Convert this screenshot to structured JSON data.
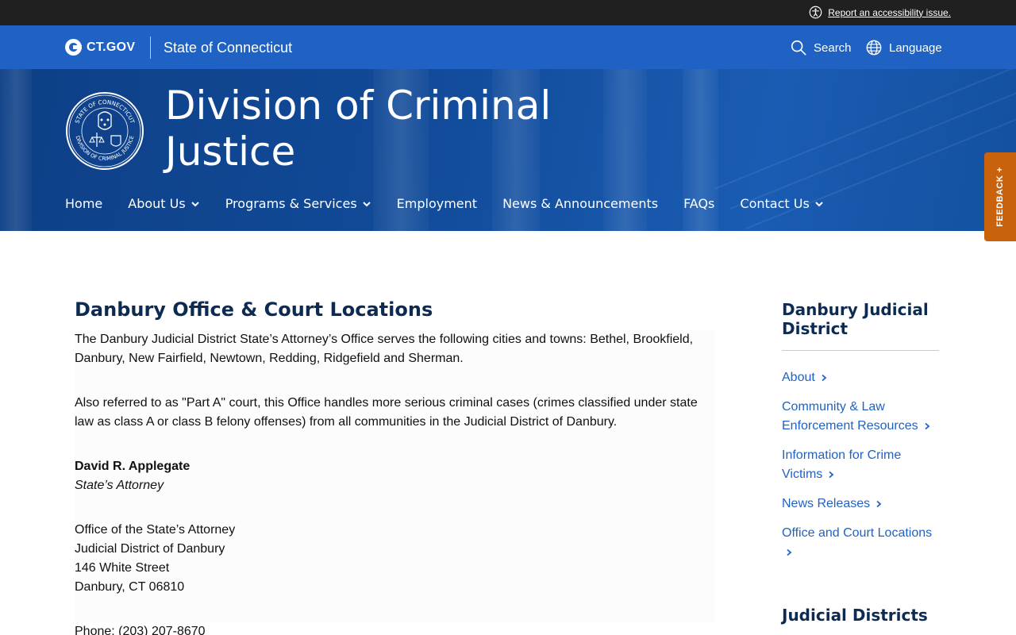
{
  "utility": {
    "accessibility_link": "Report an accessibility issue."
  },
  "ct_header": {
    "logo_text": "CT.GOV",
    "state_name": "State of Connecticut",
    "search_label": "Search",
    "language_label": "Language"
  },
  "hero": {
    "agency_title": "Division of Criminal Justice",
    "seal_top_text": "STATE OF CONNECTICUT",
    "seal_bottom_text": "DIVISION OF CRIMINAL JUSTICE"
  },
  "nav": {
    "items": [
      {
        "label": "Home",
        "has_dropdown": false
      },
      {
        "label": "About Us",
        "has_dropdown": true
      },
      {
        "label": "Programs & Services",
        "has_dropdown": true
      },
      {
        "label": "Employment",
        "has_dropdown": false
      },
      {
        "label": "News & Announcements",
        "has_dropdown": false
      },
      {
        "label": "FAQs",
        "has_dropdown": false
      },
      {
        "label": "Contact Us",
        "has_dropdown": true
      }
    ]
  },
  "feedback": {
    "label": "FEEDBACK +"
  },
  "main": {
    "title": "Danbury Office & Court Locations",
    "intro": "The Danbury Judicial District State’s Attorney’s Office serves the following cities and towns: Bethel, Brookfield, Danbury, New Fairfield, Newtown, Redding, Ridgefield and Sherman.",
    "part_a": "Also referred to as \"Part A\" court, this Office handles more serious criminal cases (crimes classified under state law as class A or class B felony offenses) from all communities in the Judicial District of Danbury.",
    "attorney_name": "David R. Applegate",
    "attorney_title": "State’s Attorney",
    "address": {
      "line1": "Office of the State’s Attorney",
      "line2": "Judicial District of Danbury",
      "line3": "146 White Street",
      "line4": "Danbury, CT 06810"
    },
    "phone": "Phone: (203) 207-8670"
  },
  "sidebar": {
    "title": "Danbury Judicial District",
    "links": [
      {
        "label": "About"
      },
      {
        "label": "Community & Law Enforcement Resources"
      },
      {
        "label": "Information for Crime Victims"
      },
      {
        "label": "News Releases"
      },
      {
        "label": "Office and Court Locations"
      }
    ],
    "section2_title": "Judicial Districts"
  },
  "colors": {
    "utility_bar": "#202020",
    "header_blue": "#1f62c4",
    "hero_blue": "#114a98",
    "link_blue": "#1f62c4",
    "heading_navy": "#0d2b52",
    "feedback_orange": "#c8620c"
  }
}
